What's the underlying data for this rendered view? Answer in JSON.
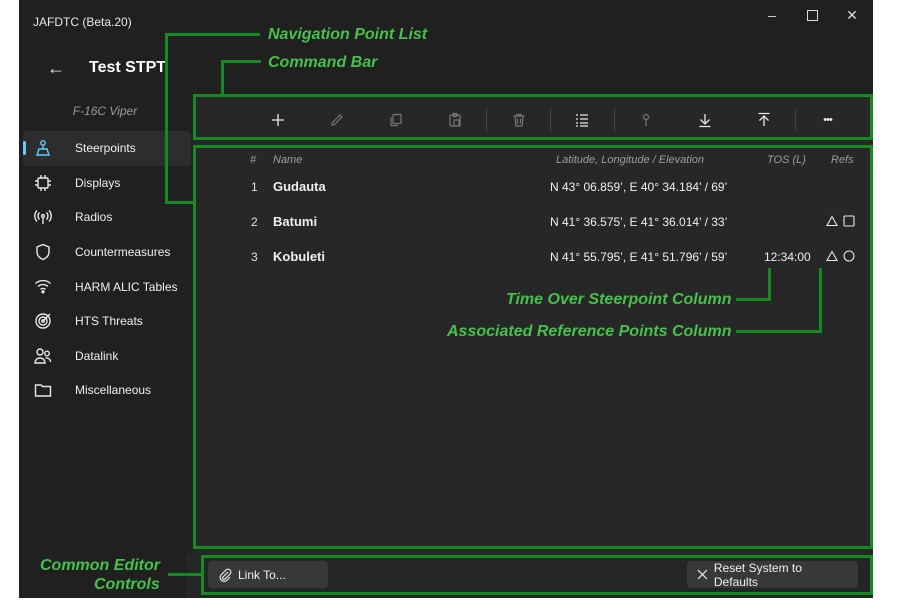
{
  "window": {
    "app_title": "JAFDTC (Beta.20)",
    "controls": {
      "minimize": "–",
      "maximize": "☐",
      "close": "✕"
    }
  },
  "header": {
    "back_icon": "←",
    "page_title": "Test STPT",
    "airframe": "F-16C Viper"
  },
  "nav": {
    "items": [
      {
        "label": "Steerpoints",
        "icon": "steerpoint-icon",
        "selected": true
      },
      {
        "label": "Displays",
        "icon": "chip-icon"
      },
      {
        "label": "Radios",
        "icon": "radio-icon"
      },
      {
        "label": "Countermeasures",
        "icon": "shield-icon"
      },
      {
        "label": "HARM ALIC Tables",
        "icon": "wifi-icon"
      },
      {
        "label": "HTS Threats",
        "icon": "target-icon"
      },
      {
        "label": "Datalink",
        "icon": "people-icon"
      },
      {
        "label": "Miscellaneous",
        "icon": "folder-icon"
      }
    ],
    "accent_color": "#60cdff"
  },
  "command_bar": {
    "more_label": "•••"
  },
  "list": {
    "headers": {
      "num": "#",
      "name": "Name",
      "position": "Latitude, Longitude / Elevation",
      "tos": "TOS (L)",
      "refs": "Refs"
    },
    "rows": [
      {
        "num": "1",
        "name": "Gudauta",
        "position": "N 43° 06.859’, E 40° 34.184’ / 69’",
        "tos": "",
        "refs": []
      },
      {
        "num": "2",
        "name": "Batumi",
        "position": "N 41° 36.575’, E 41° 36.014’ / 33’",
        "tos": "",
        "refs": [
          "triangle",
          "square"
        ]
      },
      {
        "num": "3",
        "name": "Kobuleti",
        "position": "N 41° 55.795’, E 41° 51.796’ / 59’",
        "tos": "12:34:00",
        "refs": [
          "triangle",
          "circle"
        ]
      }
    ]
  },
  "footer": {
    "link_label": "Link To...",
    "reset_label": "Reset System to Defaults"
  },
  "callouts": {
    "nav_list": "Navigation Point List",
    "command_bar": "Command Bar",
    "tos_column": "Time Over Steerpoint Column",
    "refs_column": "Associated Reference Points Column",
    "editor_line1": "Common Editor",
    "editor_line2": "Controls",
    "color": "#43c34a"
  }
}
